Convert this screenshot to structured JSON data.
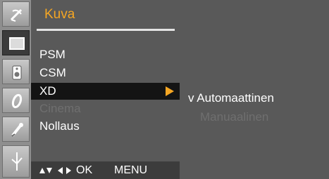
{
  "menu": {
    "title": "Kuva",
    "items": [
      {
        "label": "PSM",
        "state": "normal"
      },
      {
        "label": "CSM",
        "state": "normal"
      },
      {
        "label": "XD",
        "state": "selected"
      },
      {
        "label": "Cinema",
        "state": "disabled"
      },
      {
        "label": "Nollaus",
        "state": "normal"
      }
    ]
  },
  "icons": [
    {
      "name": "satellite-dish-icon",
      "active": false
    },
    {
      "name": "screen-icon",
      "active": true
    },
    {
      "name": "speaker-icon",
      "active": false
    },
    {
      "name": "clock-icon",
      "active": false
    },
    {
      "name": "key-icon",
      "active": false
    },
    {
      "name": "signal-icon",
      "active": false
    }
  ],
  "submenu": {
    "check_mark": "v",
    "items": [
      {
        "label": "Automaattinen",
        "checked": true,
        "state": "normal"
      },
      {
        "label": "Manuaalinen",
        "checked": false,
        "state": "disabled"
      }
    ]
  },
  "nav": {
    "ok_label": "OK",
    "menu_label": "MENU"
  },
  "colors": {
    "accent": "#f5a623",
    "panel": "#595959",
    "selected_bg": "#141414",
    "disabled_text": "#6f6f6f"
  }
}
